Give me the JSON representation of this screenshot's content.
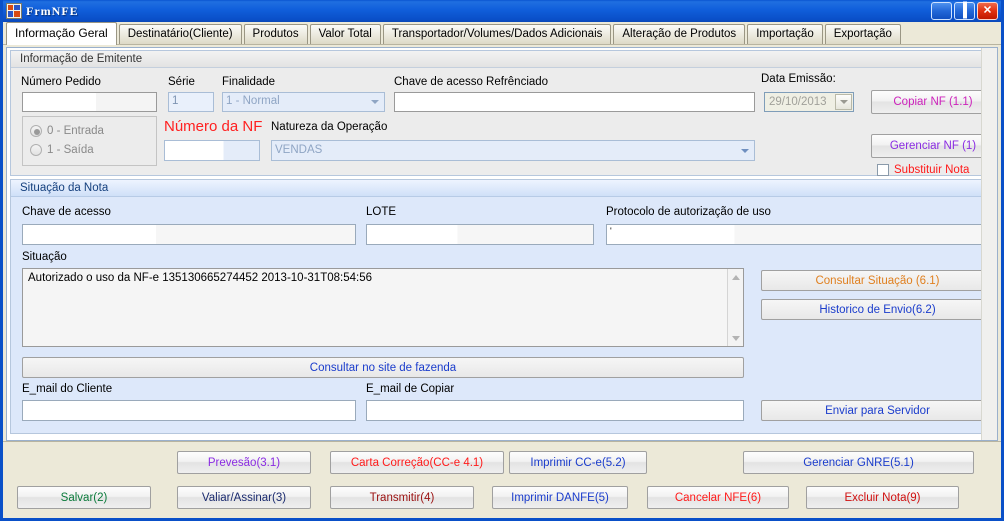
{
  "window": {
    "title": "FrmNFE",
    "icon": "app-icon",
    "buttons": {
      "minimize": "minimize-icon",
      "maximize": "maximize-icon",
      "close": "close-icon"
    }
  },
  "tabs": [
    {
      "label": "Informação Geral",
      "active": true
    },
    {
      "label": "Destinatário(Cliente)",
      "active": false
    },
    {
      "label": "Produtos",
      "active": false
    },
    {
      "label": "Valor Total",
      "active": false
    },
    {
      "label": "Transportador/Volumes/Dados Adicionais",
      "active": false
    },
    {
      "label": "Alteração de Produtos",
      "active": false
    },
    {
      "label": "Importação",
      "active": false
    },
    {
      "label": "Exportação",
      "active": false
    }
  ],
  "emitente": {
    "group_title": "Informação de Emitente",
    "numero_pedido_label": "Número Pedido",
    "numero_pedido_value": "",
    "serie_label": "Série",
    "serie_value": "1",
    "finalidade_label": "Finalidade",
    "finalidade_value": "1 - Normal",
    "chave_ref_label": "Chave de acesso Refrênciado",
    "chave_ref_value": "",
    "data_emissao_label": "Data Emissão:",
    "data_emissao_value": "29/10/2013",
    "tipo_options": [
      {
        "label": "0 - Entrada",
        "selected": true
      },
      {
        "label": "1 - Saída",
        "selected": false
      }
    ],
    "numero_nf_label": "Número da NF",
    "numero_nf_value": "",
    "natureza_label": "Natureza da Operação",
    "natureza_value": "VENDAS",
    "copiar_nf_label": "Copiar NF (1.1)",
    "gerenciar_nf_label": "Gerenciar NF (1)",
    "substituir_nota_label": "Substituir Nota",
    "substituir_nota_checked": false
  },
  "situacao": {
    "group_title": "Situação da Nota",
    "chave_acesso_label": "Chave de acesso",
    "chave_acesso_value": "",
    "lote_label": "LOTE",
    "lote_value": "",
    "protocolo_label": "Protocolo de autorização de uso",
    "protocolo_value": "'",
    "situacao_label": "Situação",
    "situacao_text": "Autorizado o uso da NF-e 135130665274452 2013-10-31T08:54:56",
    "consultar_situacao_label": "Consultar Situação (6.1)",
    "historico_envio_label": "Historico de Envio(6.2)",
    "consultar_site_label": "Consultar no site de fazenda",
    "email_cliente_label": "E_mail do Cliente",
    "email_cliente_value": "",
    "email_copiar_label": "E_mail de Copiar",
    "email_copiar_value": "",
    "enviar_servidor_label": "Enviar para Servidor"
  },
  "toolbar": {
    "row1": [
      {
        "label": "Prevesão(3.1)",
        "color": "#8a2be2"
      },
      {
        "label": "Carta Correção(CC-e 4.1)",
        "color": "#ff1a1a"
      },
      {
        "label": "Imprimir CC-e(5.2)",
        "color": "#1a3ccc"
      },
      {
        "label": "Gerenciar GNRE(5.1)",
        "color": "#1a3ccc"
      }
    ],
    "row2": [
      {
        "label": "Salvar(2)",
        "color": "#0a7a3a"
      },
      {
        "label": "Valiar/Assinar(3)",
        "color": "#1a2a6e"
      },
      {
        "label": "Transmitir(4)",
        "color": "#9a1010"
      },
      {
        "label": "Imprimir DANFE(5)",
        "color": "#1a3ccc"
      },
      {
        "label": "Cancelar NFE(6)",
        "color": "#ff1a1a"
      },
      {
        "label": "Excluir Nota(9)",
        "color": "#d01010"
      }
    ]
  },
  "colors": {
    "titlebar": "#0a50c8",
    "panel": "#ece9d8",
    "group_blue": "#dde8fa",
    "accent_red": "#ff1a1a",
    "accent_magenta": "#cc22bb",
    "accent_orange": "#e08020"
  }
}
